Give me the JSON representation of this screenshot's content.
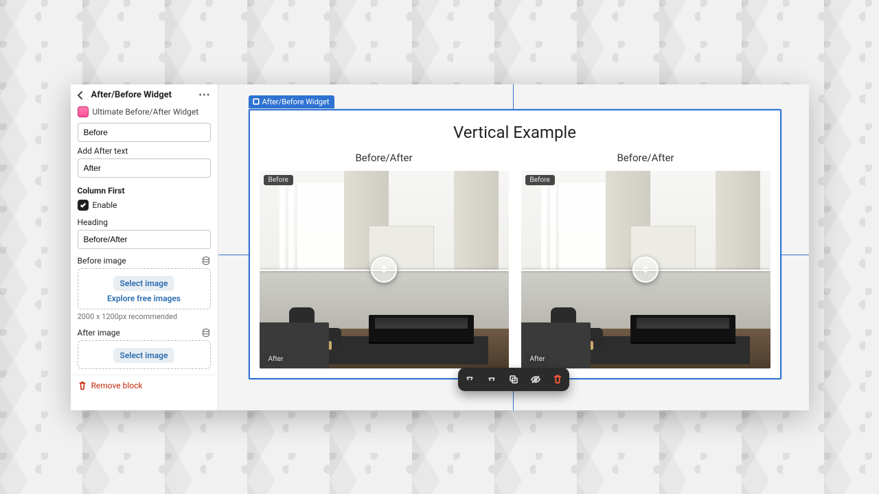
{
  "sidebar": {
    "title": "After/Before Widget",
    "app_name": "Ultimate Before/After Widget",
    "before_input": {
      "value": "Before"
    },
    "add_after_label": "Add After text",
    "after_input": {
      "value": "After"
    },
    "column_first_label": "Column First",
    "enable_label": "Enable",
    "heading_label": "Heading",
    "heading_input": {
      "value": "Before/After"
    },
    "before_image_label": "Before image",
    "after_image_label": "After image",
    "select_image_label": "Select image",
    "explore_label": "Explore free images",
    "size_hint": "2000 x 1200px recommended",
    "remove_label": "Remove block"
  },
  "canvas": {
    "tag_label": "After/Before Widget",
    "section_title": "Vertical Example",
    "columns": [
      {
        "title": "Before/After",
        "before_badge": "Before",
        "after_badge": "After"
      },
      {
        "title": "Before/After",
        "before_badge": "Before",
        "after_badge": "After"
      }
    ]
  }
}
